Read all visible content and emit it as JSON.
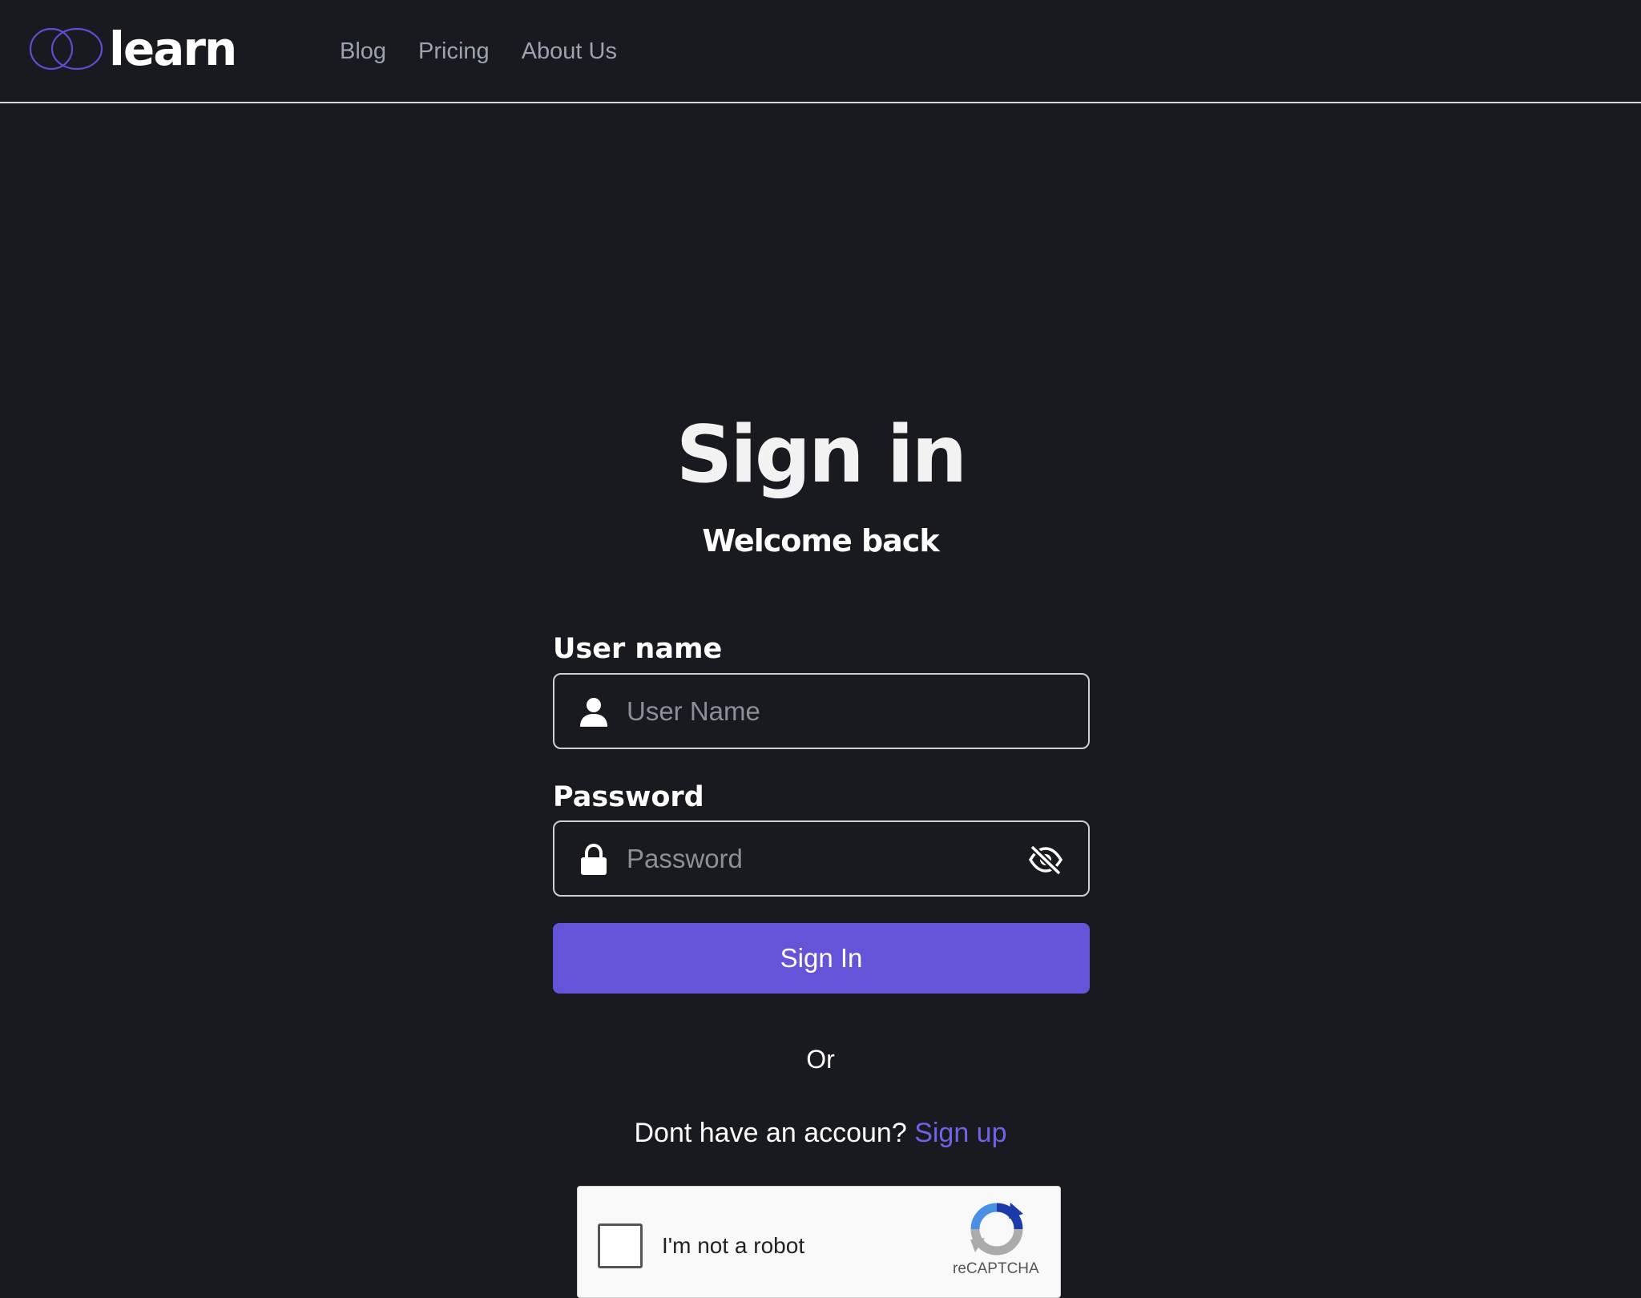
{
  "header": {
    "logo_text": "learn",
    "nav": [
      {
        "label": "Blog"
      },
      {
        "label": "Pricing"
      },
      {
        "label": "About Us"
      }
    ]
  },
  "main": {
    "title": "Sign in",
    "subtitle": "Welcome back",
    "username": {
      "label": "User name",
      "placeholder": "User Name",
      "value": ""
    },
    "password": {
      "label": "Password",
      "placeholder": "Password",
      "value": ""
    },
    "signin_button": "Sign In",
    "divider_text": "Or",
    "signup_prompt": "Dont have an accoun?",
    "signup_link": "Sign up"
  },
  "captcha": {
    "label": "I'm not a robot",
    "brand": "reCAPTCHA"
  },
  "colors": {
    "background": "#181a20",
    "accent": "#6455d8",
    "link": "#6f63e6",
    "nav_text": "#9ba3af"
  }
}
